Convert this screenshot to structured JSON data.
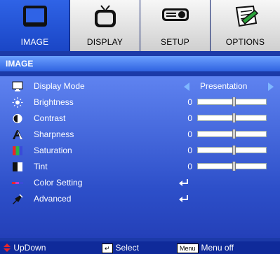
{
  "tabs": [
    {
      "label": "IMAGE",
      "icon": "monitor-icon",
      "active": true
    },
    {
      "label": "DISPLAY",
      "icon": "tv-icon",
      "active": false
    },
    {
      "label": "SETUP",
      "icon": "projector-icon",
      "active": false
    },
    {
      "label": "OPTIONS",
      "icon": "options-icon",
      "active": false
    }
  ],
  "header": {
    "title": "IMAGE"
  },
  "menu": [
    {
      "label": "Display Mode",
      "icon": "monitor-small-icon",
      "type": "choice",
      "value": "Presentation"
    },
    {
      "label": "Brightness",
      "icon": "sun-icon",
      "type": "slider",
      "value": "0",
      "level": 0.5
    },
    {
      "label": "Contrast",
      "icon": "contrast-icon",
      "type": "slider",
      "value": "0",
      "level": 0.5
    },
    {
      "label": "Sharpness",
      "icon": "sharpness-icon",
      "type": "slider",
      "value": "0",
      "level": 0.5
    },
    {
      "label": "Saturation",
      "icon": "saturation-icon",
      "type": "slider",
      "value": "0",
      "level": 0.5
    },
    {
      "label": "Tint",
      "icon": "tint-icon",
      "type": "slider",
      "value": "0",
      "level": 0.5
    },
    {
      "label": "Color Setting",
      "icon": "color-setting-icon",
      "type": "enter"
    },
    {
      "label": "Advanced",
      "icon": "advanced-icon",
      "type": "enter"
    }
  ],
  "footer": {
    "updown": "UpDown",
    "select": "Select",
    "menu_key": "Menu",
    "menu_off": "Menu off"
  }
}
